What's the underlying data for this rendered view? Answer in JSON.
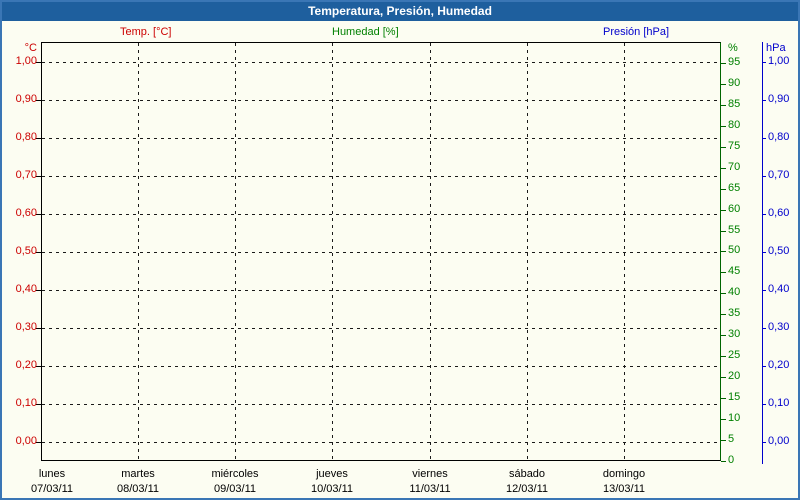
{
  "window": {
    "title": "Temperatura, Presión, Humedad"
  },
  "legend": [
    {
      "label": "Temp. [°C]",
      "color": "#cc0000"
    },
    {
      "label": "Humedad [%]",
      "color": "#008000"
    },
    {
      "label": "Presión [hPa]",
      "color": "#0000cc"
    }
  ],
  "chart_data": {
    "type": "line",
    "title": "Temperatura, Presión, Humedad",
    "note": "empty plot - no data series drawn, axes and grid only",
    "grid": true,
    "legend_position": "top",
    "series": [
      {
        "name": "Temp. [°C]",
        "axis": "temperature",
        "color": "#cc0000",
        "x": [],
        "values": []
      },
      {
        "name": "Humedad [%]",
        "axis": "humidity",
        "color": "#008000",
        "x": [],
        "values": []
      },
      {
        "name": "Presión [hPa]",
        "axis": "pressure",
        "color": "#0000cc",
        "x": [],
        "values": []
      }
    ],
    "y_axis_temperature": {
      "title": "°C",
      "color": "#cc0000",
      "side": "left",
      "min": 0.0,
      "max": 1.0,
      "tick_step": 0.1,
      "tick_labels": [
        "1,00",
        "0,90",
        "0,80",
        "0,70",
        "0,60",
        "0,50",
        "0,40",
        "0,30",
        "0,20",
        "0,10",
        "0,00"
      ]
    },
    "y_axis_humidity": {
      "title": "%",
      "color": "#008000",
      "axis_line_color": "#006400",
      "side": "right-inner",
      "min": 0,
      "max": 100,
      "tick_step": 5,
      "tick_labels": [
        "95",
        "90",
        "85",
        "80",
        "75",
        "70",
        "65",
        "60",
        "55",
        "50",
        "45",
        "40",
        "35",
        "30",
        "25",
        "20",
        "15",
        "10",
        "5",
        "0"
      ]
    },
    "y_axis_pressure": {
      "title": "hPa",
      "color": "#0000cc",
      "side": "right-outer",
      "min": 0.0,
      "max": 1.0,
      "tick_step": 0.1,
      "tick_labels": [
        "1,00",
        "0,90",
        "0,80",
        "0,70",
        "0,60",
        "0,50",
        "0,40",
        "0,30",
        "0,20",
        "0,10",
        "0,00"
      ]
    },
    "x_axis": {
      "days": [
        {
          "name": "lunes",
          "date": "07/03/11"
        },
        {
          "name": "martes",
          "date": "08/03/11"
        },
        {
          "name": "miércoles",
          "date": "09/03/11"
        },
        {
          "name": "jueves",
          "date": "10/03/11"
        },
        {
          "name": "viernes",
          "date": "11/03/11"
        },
        {
          "name": "sábado",
          "date": "12/03/11"
        },
        {
          "name": "domingo",
          "date": "13/03/11"
        }
      ]
    }
  }
}
